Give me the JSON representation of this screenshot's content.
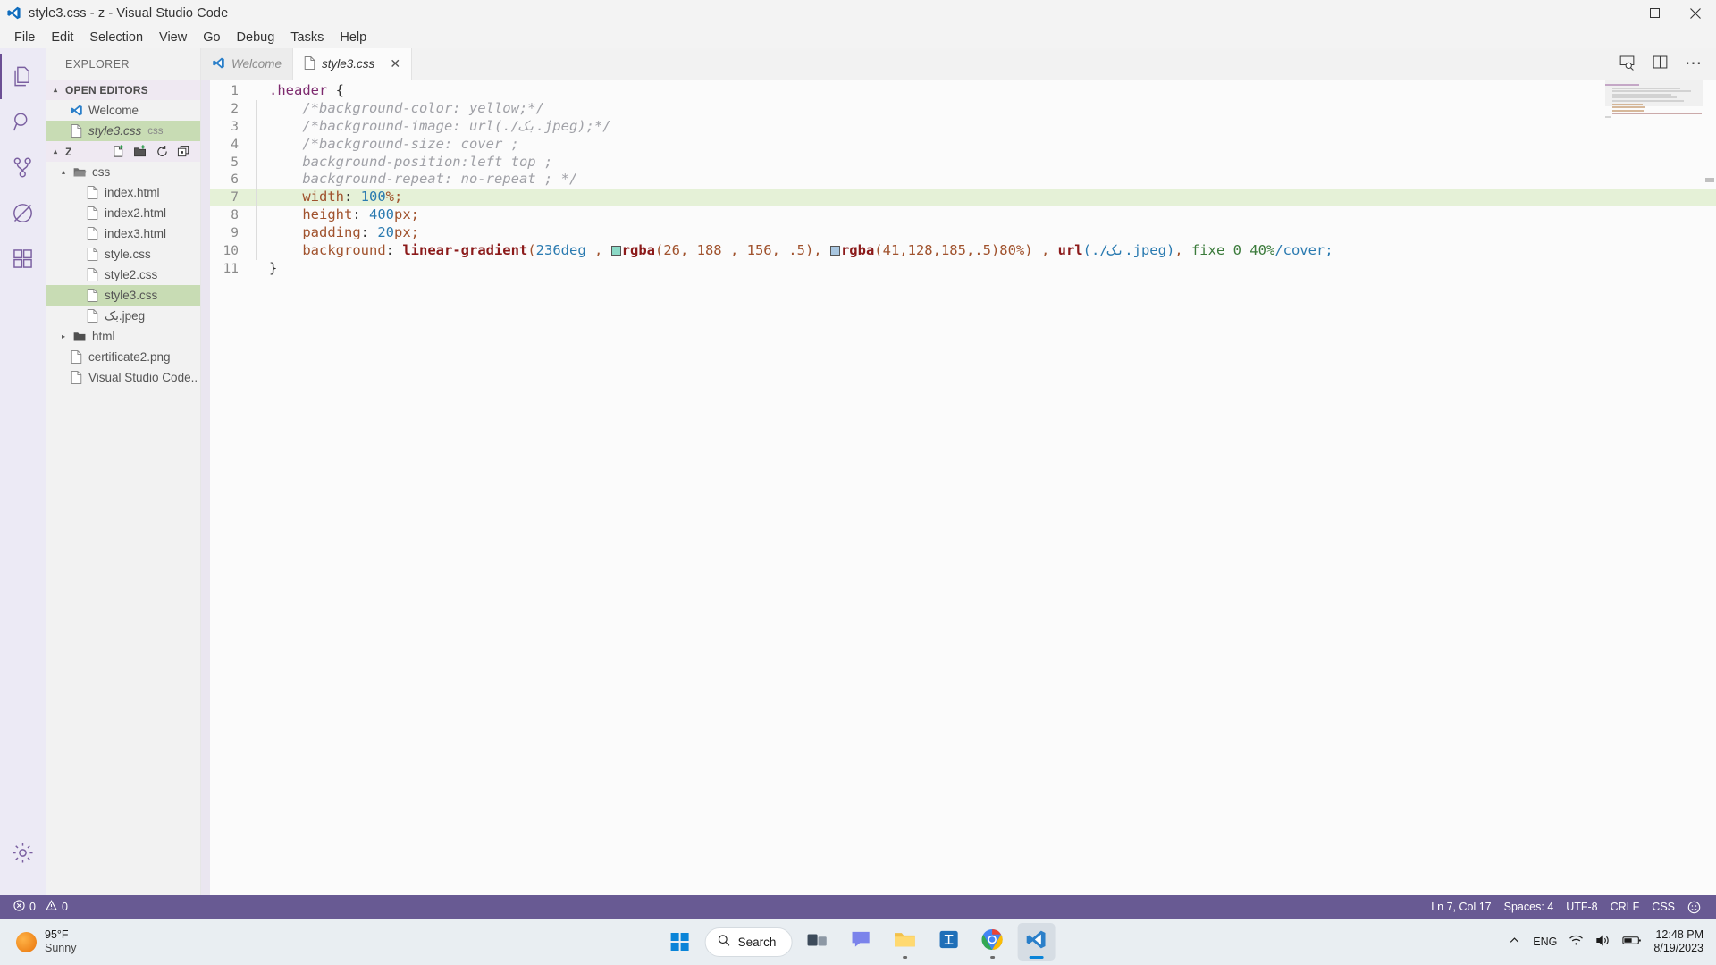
{
  "window": {
    "title": "style3.css - z - Visual Studio Code",
    "logo_icon": "vscode-logo-icon",
    "controls": {
      "minimize": "minimize-icon",
      "maximize": "maximize-icon",
      "close": "close-icon"
    }
  },
  "menubar": {
    "items": [
      "File",
      "Edit",
      "Selection",
      "View",
      "Go",
      "Debug",
      "Tasks",
      "Help"
    ]
  },
  "activitybar": {
    "items": [
      {
        "name": "explorer",
        "icon": "files-icon",
        "active": true
      },
      {
        "name": "search",
        "icon": "search-icon",
        "active": false
      },
      {
        "name": "source-control",
        "icon": "source-control-icon",
        "active": false
      },
      {
        "name": "run-debug",
        "icon": "debug-icon",
        "active": false
      },
      {
        "name": "extensions",
        "icon": "extensions-icon",
        "active": false
      }
    ],
    "bottom": [
      {
        "name": "manage",
        "icon": "gear-icon"
      }
    ]
  },
  "sidebar": {
    "title": "EXPLORER",
    "open_editors": {
      "label": "OPEN EDITORS",
      "twisty": "▴",
      "items": [
        {
          "label": "Welcome",
          "icon": "vscode-logo-icon",
          "meta": "",
          "italic": false,
          "selected": false,
          "indent": 26
        },
        {
          "label": "style3.css",
          "icon": "file-icon",
          "meta": "css",
          "italic": true,
          "selected": true,
          "indent": 26
        }
      ]
    },
    "folder": {
      "label": "Z",
      "twisty": "▴",
      "actions": [
        {
          "name": "new-file-icon"
        },
        {
          "name": "new-folder-icon"
        },
        {
          "name": "refresh-icon"
        },
        {
          "name": "collapse-all-icon"
        }
      ],
      "items": [
        {
          "label": "css",
          "icon": "folder-open-icon",
          "type": "folder",
          "twisty": "▴",
          "indent": 18,
          "selected": false
        },
        {
          "label": "index.html",
          "icon": "file-icon",
          "type": "file",
          "indent": 44,
          "selected": false
        },
        {
          "label": "index2.html",
          "icon": "file-icon",
          "type": "file",
          "indent": 44,
          "selected": false
        },
        {
          "label": "index3.html",
          "icon": "file-icon",
          "type": "file",
          "indent": 44,
          "selected": false
        },
        {
          "label": "style.css",
          "icon": "file-icon",
          "type": "file",
          "indent": 44,
          "selected": false
        },
        {
          "label": "style2.css",
          "icon": "file-icon",
          "type": "file",
          "indent": 44,
          "selected": false
        },
        {
          "label": "style3.css",
          "icon": "file-icon",
          "type": "file",
          "indent": 44,
          "selected": true
        },
        {
          "label": "بک.jpeg",
          "icon": "file-icon",
          "type": "file",
          "indent": 44,
          "selected": false
        },
        {
          "label": "html",
          "icon": "folder-icon",
          "type": "folder",
          "twisty": "▸",
          "indent": 18,
          "selected": false
        },
        {
          "label": "certificate2.png",
          "icon": "file-icon",
          "type": "file",
          "indent": 26,
          "selected": false
        },
        {
          "label": "Visual Studio Code..",
          "icon": "file-icon",
          "type": "file",
          "indent": 26,
          "selected": false
        }
      ]
    }
  },
  "tabs": {
    "items": [
      {
        "label": "Welcome",
        "icon": "vscode-logo-icon",
        "active": false,
        "italic": true,
        "closable": false
      },
      {
        "label": "style3.css",
        "icon": "file-icon",
        "active": true,
        "italic": true,
        "closable": true,
        "close_glyph": "✕"
      }
    ],
    "actions": [
      {
        "name": "open-preview-icon"
      },
      {
        "name": "split-editor-icon"
      },
      {
        "name": "more-actions-icon",
        "glyph": "⋯"
      }
    ]
  },
  "editor": {
    "language": "CSS",
    "lines": [
      {
        "n": 1,
        "highlight": false
      },
      {
        "n": 2,
        "highlight": false
      },
      {
        "n": 3,
        "highlight": false
      },
      {
        "n": 4,
        "highlight": false
      },
      {
        "n": 5,
        "highlight": false
      },
      {
        "n": 6,
        "highlight": false
      },
      {
        "n": 7,
        "highlight": true
      },
      {
        "n": 8,
        "highlight": false
      },
      {
        "n": 9,
        "highlight": false
      },
      {
        "n": 10,
        "highlight": false
      },
      {
        "n": 11,
        "highlight": false
      }
    ],
    "text": {
      "l1_sel": ".header",
      "l1_brace": "{",
      "l2": "/*background-color: yellow;*/",
      "l3": "/*background-image: url(./بک.jpeg);*/",
      "l4": "/*background-size: cover ;",
      "l5": "background-position:left top ;",
      "l6": "background-repeat: no-repeat ; */",
      "l7_prop": "width",
      "l7_colon": ": ",
      "l7_val": "100",
      "l7_unit": "%;",
      "l8_prop": "height",
      "l8_colon": ": ",
      "l8_val": "400",
      "l8_unit": "px;",
      "l9_prop": "padding",
      "l9_colon": ": ",
      "l9_val": "20",
      "l9_unit": "px;",
      "l10_prop": "background",
      "l10_colon": ": ",
      "l10_fn": "linear-gradient",
      "l10_open": "(",
      "l10_deg": "236deg",
      "l10_c1": " , ",
      "l10_rgba1": "rgba",
      "l10_rgba1_args": "(26, 188 , 156, .5)",
      "l10_c2": ", ",
      "l10_rgba2": "rgba",
      "l10_rgba2_args": "(41,128,185,.5)80%)",
      "l10_c3": " , ",
      "l10_url": "url",
      "l10_urlarg": "(./بک.jpeg)",
      "l10_c4": ", ",
      "l10_fixe": "fixe 0 40%",
      "l10_cover": "/cover;",
      "l11_brace": "}"
    },
    "swatches": {
      "color1": "#8bd9c6",
      "color2": "#a8c6e0"
    }
  },
  "statusbar": {
    "errors_icon": "error-icon",
    "errors": "0",
    "warnings_icon": "warning-icon",
    "warnings": "0",
    "cursor": "Ln 7, Col 17",
    "indent": "Spaces: 4",
    "encoding": "UTF-8",
    "eol": "CRLF",
    "language": "CSS",
    "feedback_icon": "smiley-icon",
    "background": "#685a93"
  },
  "taskbar": {
    "weather": {
      "temp": "95°F",
      "condition": "Sunny",
      "icon": "sun-icon"
    },
    "start_icon": "windows-start-icon",
    "search": {
      "label": "Search",
      "icon": "search-icon"
    },
    "apps": [
      {
        "name": "task-view-icon",
        "running": false
      },
      {
        "name": "chat-teams-icon",
        "running": false
      },
      {
        "name": "file-explorer-icon",
        "running": true
      },
      {
        "name": "microsoft-store-icon",
        "running": false
      },
      {
        "name": "google-chrome-icon",
        "running": true
      },
      {
        "name": "visual-studio-code-icon",
        "running": true,
        "active": true
      }
    ],
    "tray": {
      "chevron_icon": "chevron-up-icon",
      "language": "ENG",
      "wifi_icon": "wifi-icon",
      "volume_icon": "volume-icon",
      "battery_icon": "battery-icon"
    },
    "clock": {
      "time": "12:48 PM",
      "date": "8/19/2023"
    }
  }
}
